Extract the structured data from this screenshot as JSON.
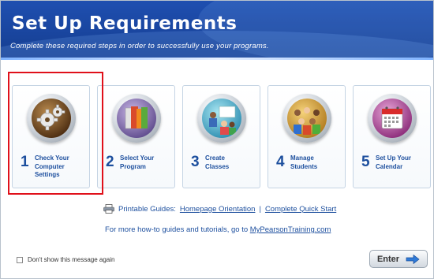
{
  "header": {
    "title": "Set Up Requirements",
    "subtitle": "Complete these required steps in order to successfully use your programs."
  },
  "steps": [
    {
      "number": "1",
      "label": "Check Your\nComputer\nSettings",
      "icon": "gears-icon"
    },
    {
      "number": "2",
      "label": "Select Your\nProgram",
      "icon": "books-icon"
    },
    {
      "number": "3",
      "label": "Create\nClasses",
      "icon": "classroom-icon"
    },
    {
      "number": "4",
      "label": "Manage\nStudents",
      "icon": "students-group-icon"
    },
    {
      "number": "5",
      "label": "Set Up Your\nCalendar",
      "icon": "calendar-icon"
    }
  ],
  "guides": {
    "label": "Printable Guides:",
    "homepage_link": "Homepage Orientation",
    "separator": "|",
    "quickstart_link": "Complete Quick Start"
  },
  "training": {
    "text": "For more how-to guides and tutorials, go to ",
    "link": "MyPearsonTraining.com"
  },
  "footer": {
    "dont_show": "Don't show this message again",
    "enter_label": "Enter"
  },
  "colors": {
    "header_blue": "#1a47a2",
    "link_blue": "#1d4f9e",
    "highlight_red": "#e0101a"
  }
}
